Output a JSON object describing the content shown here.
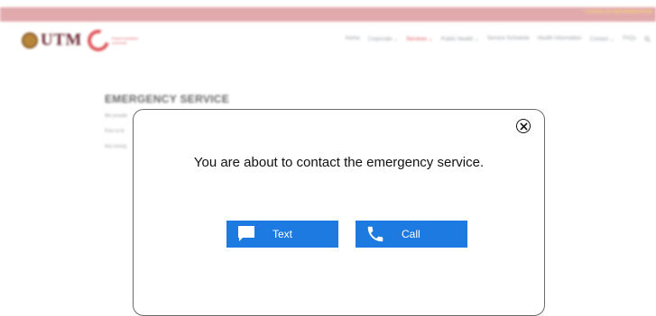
{
  "topbar": {
    "link_text": "COVID-19 INFORMATION"
  },
  "header": {
    "logo_text": "UTM",
    "logo_sub": "Pusat Kesihatan Universiti",
    "nav": [
      {
        "label": "Home"
      },
      {
        "label": "Corporate ⌄"
      },
      {
        "label": "Services ⌄"
      },
      {
        "label": "Public Health ⌄"
      },
      {
        "label": "Service Schedule"
      },
      {
        "label": "Health Information"
      },
      {
        "label": "Contact ⌄"
      },
      {
        "label": "FAQs"
      }
    ]
  },
  "content": {
    "title": "EMERGENCY SERVICE",
    "lines": [
      "We provide",
      "Prior to fe",
      "Any emerg"
    ]
  },
  "modal": {
    "message": "You are about to contact the emergency service.",
    "text_button": "Text",
    "call_button": "Call"
  },
  "colors": {
    "accent": "#1c7ae0",
    "topbar": "#e2a9ad",
    "brand_red": "#e05a5f"
  },
  "icons": {
    "close": "close-circle-icon",
    "text": "chat-bubble-icon",
    "call": "phone-icon",
    "search": "search-icon"
  }
}
